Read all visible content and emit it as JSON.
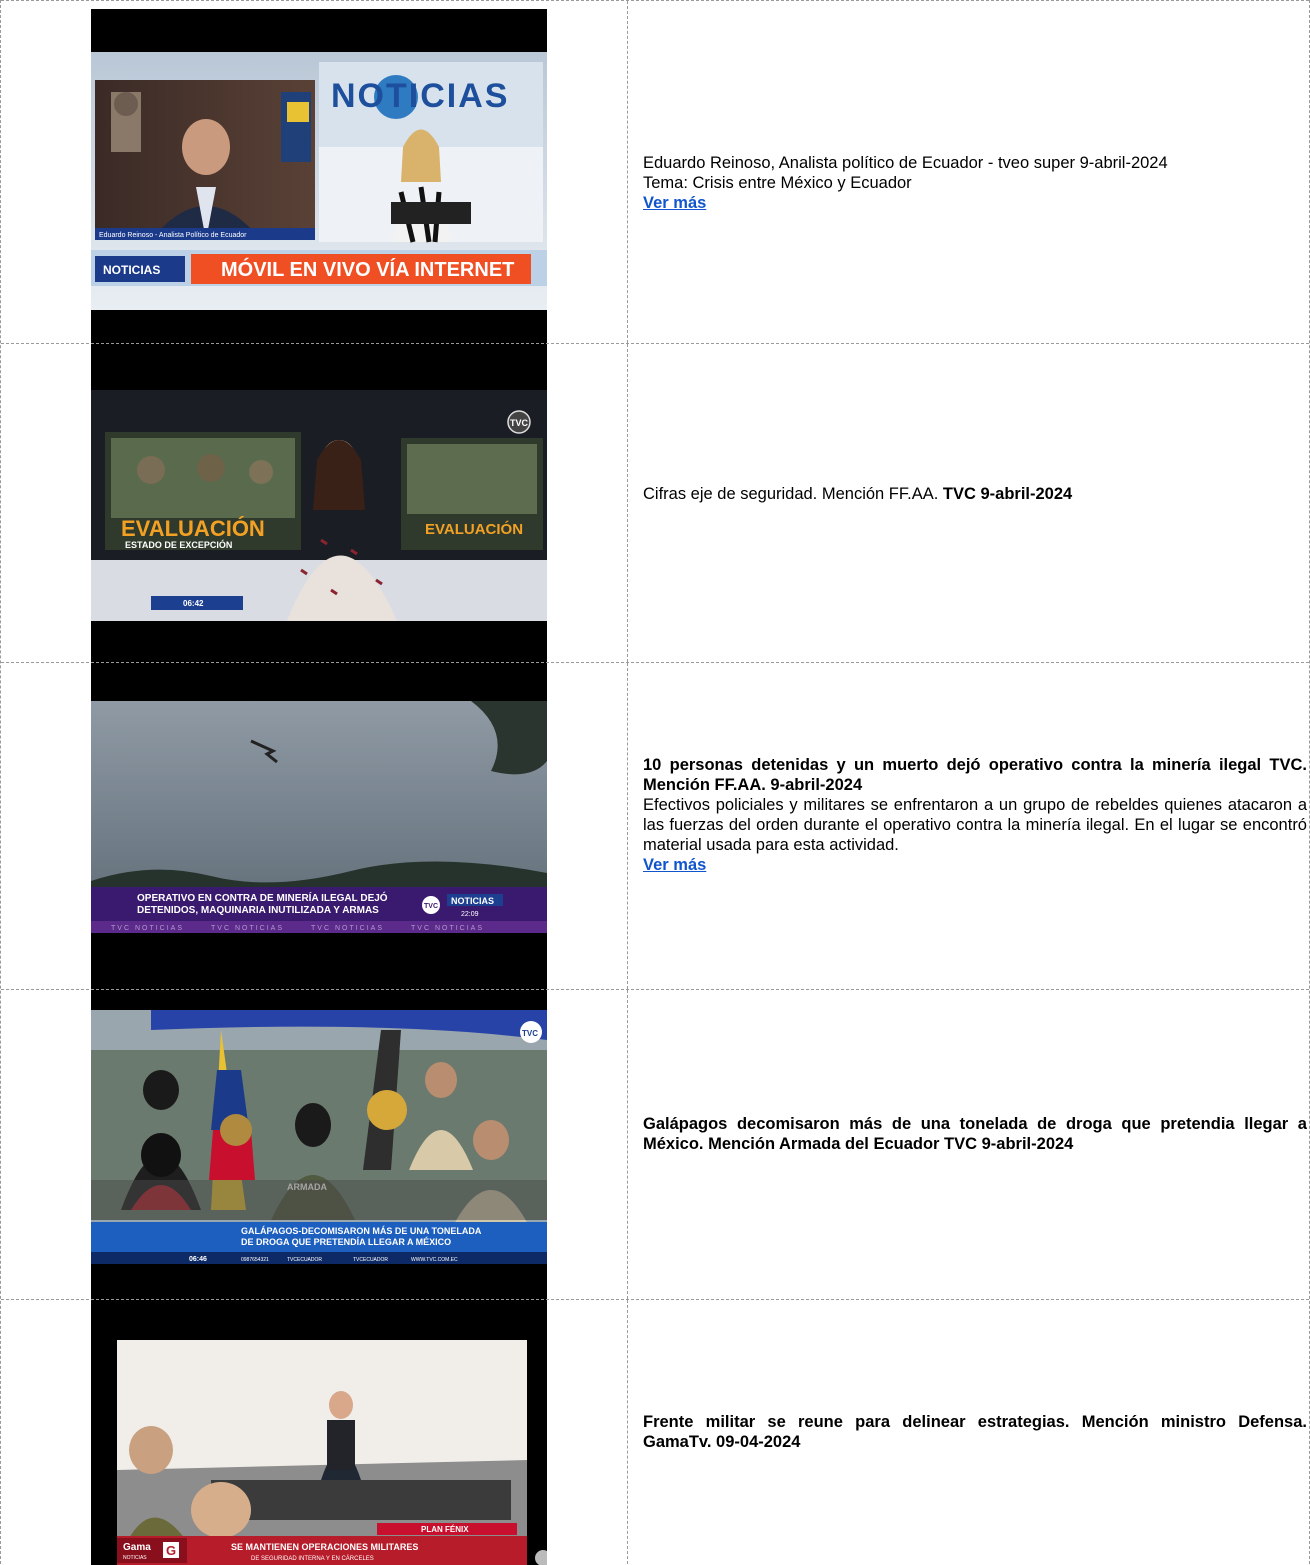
{
  "items": [
    {
      "lines": [
        "Eduardo Reinoso, Analista político de Ecuador - tveo super 9-abril-2024",
        "Tema: Crisis entre México y Ecuador"
      ],
      "link": "Ver más",
      "video": {
        "logo": "NOTICIAS",
        "caption": "Eduardo Reinoso - Analista Político de Ecuador",
        "badge": "NOTICIAS",
        "banner": "MÓVIL EN VIVO VÍA INTERNET"
      }
    },
    {
      "text_plain": "Cifras eje de seguridad. Mención FF.AA.",
      "text_bold": "TVC  9-abril-2024",
      "video": {
        "screen_title": "EVALUACIÓN",
        "screen_sub": "ESTADO DE EXCEPCIÓN",
        "channel": "TVC",
        "time": "06:42"
      }
    },
    {
      "headline": "10 personas detenidas y un muerto dejó operativo contra la minería ilegal TVC. Mención  FF.AA.  9-abril-2024",
      "body": "Efectivos policiales y militares se enfrentaron a un grupo de rebeldes quienes atacaron a las fuerzas del orden durante el operativo contra la minería ilegal. En el lugar se encontró material usada para esta actividad.",
      "link": "Ver más",
      "video": {
        "lower_third": [
          "OPERATIVO EN CONTRA DE MINERÍA ILEGAL DEJÓ",
          "DETENIDOS, MAQUINARIA INUTILIZADA Y ARMAS"
        ],
        "channel": "TVC",
        "badge": "NOTICIAS",
        "time": "22:09",
        "ticker": "TVC NOTICIAS"
      }
    },
    {
      "headline": "Galápagos decomisaron más de una tonelada  de droga que pretendia llegar a México. Mención Armada del Ecuador  TVC  9-abril-2024",
      "video": {
        "lower_third": [
          "GALÁPAGOS-DECOMISARON MÁS DE UNA TONELADA",
          "DE DROGA QUE PRETENDÍA LLEGAR A MÉXICO"
        ],
        "channel": "TVC",
        "time": "06:46",
        "socials": [
          "0987654321",
          "TVCECUADOR",
          "TVCECUADOR",
          "WWW.TVC.COM.EC"
        ],
        "uniform_text": "ARMADA"
      }
    },
    {
      "headline": "Frente militar se reune para delinear estrategias. Mención ministro Defensa. GamaTv. 09-04-2024",
      "video": {
        "tag": "PLAN FÉNIX",
        "lower_third": [
          "SE MANTIENEN OPERACIONES MILITARES",
          "DE SEGURIDAD INTERNA Y EN CÁRCELES"
        ],
        "brand": "Gama",
        "brand_sub": "NOTICIAS",
        "brand_icon": "G"
      }
    }
  ],
  "colors": {
    "link": "#1155cc",
    "banner_orange": "#f04e23",
    "tvc_purple": "#3b1a6e",
    "tvc_blue": "#1d3f8f",
    "gama_red": "#c8102e"
  }
}
